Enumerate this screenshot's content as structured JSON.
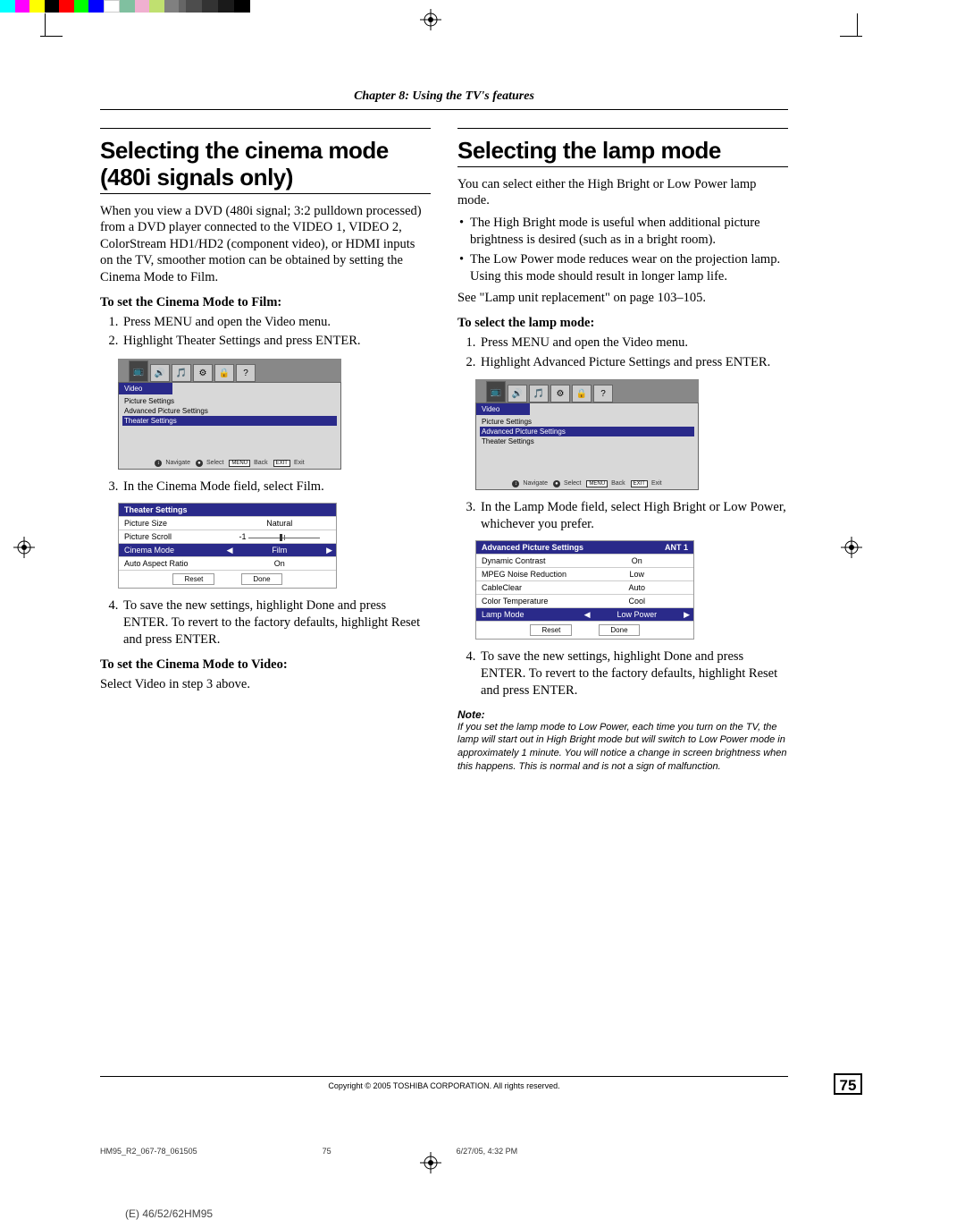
{
  "chapter": "Chapter 8: Using the TV's features",
  "left": {
    "heading": "Selecting the cinema mode (480i signals only)",
    "intro": "When you view a DVD (480i signal; 3:2 pulldown processed) from a DVD player connected to the VIDEO 1, VIDEO 2, ColorStream HD1/HD2 (component video), or HDMI inputs on the TV, smoother motion can be obtained by setting the Cinema Mode to Film.",
    "lead1": "To set the Cinema Mode to Film:",
    "step1": "Press MENU and open the Video menu.",
    "step2": "Highlight Theater Settings and press ENTER.",
    "osd": {
      "title": "Video",
      "items": [
        "Picture Settings",
        "Advanced Picture Settings",
        "Theater Settings"
      ],
      "footer": {
        "nav": "Navigate",
        "sel": "Select",
        "back": "Back",
        "exit": "Exit",
        "menu": "MENU",
        "exitbtn": "EXIT"
      }
    },
    "step3": "In the Cinema Mode field, select Film.",
    "table": {
      "title": "Theater Settings",
      "rows": [
        {
          "label": "Picture Size",
          "value": "Natural"
        },
        {
          "label": "Picture Scroll",
          "value": "-1"
        },
        {
          "label": "Cinema Mode",
          "value": "Film",
          "hl": true,
          "arrows": true
        },
        {
          "label": "Auto Aspect Ratio",
          "value": "On"
        }
      ],
      "buttons": [
        "Reset",
        "Done"
      ]
    },
    "step4": "To save the new settings, highlight Done and press ENTER. To revert to the factory defaults, highlight Reset and press ENTER.",
    "lead2": "To set the Cinema Mode to Video:",
    "lead2_text": "Select Video in step 3 above."
  },
  "right": {
    "heading": "Selecting the lamp mode",
    "intro": "You can select either the High Bright or Low Power lamp mode.",
    "bul1": "The High Bright mode is useful when additional picture brightness is desired (such as in a bright room).",
    "bul2": "The Low Power mode reduces wear on the projection lamp. Using this mode should result in longer lamp life.",
    "see": "See \"Lamp unit replacement\" on page 103–105.",
    "lead1": "To select the lamp mode:",
    "step1": "Press MENU and open the Video menu.",
    "step2": "Highlight Advanced Picture Settings and press ENTER.",
    "osd": {
      "title": "Video",
      "items": [
        "Picture Settings",
        "Advanced Picture Settings",
        "Theater Settings"
      ],
      "footer": {
        "nav": "Navigate",
        "sel": "Select",
        "back": "Back",
        "exit": "Exit",
        "menu": "MENU",
        "exitbtn": "EXIT"
      }
    },
    "step3": "In the Lamp Mode field, select High Bright or Low Power, whichever you prefer.",
    "table": {
      "title": "Advanced Picture Settings",
      "ant": "ANT 1",
      "rows": [
        {
          "label": "Dynamic Contrast",
          "value": "On"
        },
        {
          "label": "MPEG Noise Reduction",
          "value": "Low"
        },
        {
          "label": "CableClear",
          "value": "Auto"
        },
        {
          "label": "Color Temperature",
          "value": "Cool"
        },
        {
          "label": "Lamp Mode",
          "value": "Low Power",
          "hl": true,
          "arrows": true
        }
      ],
      "buttons": [
        "Reset",
        "Done"
      ]
    },
    "step4": "To save the new settings, highlight Done and press ENTER. To revert to the factory defaults, highlight Reset and press ENTER.",
    "note_head": "Note:",
    "note_text": "If you set the lamp mode to Low Power, each time you turn on the TV, the lamp will start out in High Bright mode but will switch to Low Power mode in approximately 1 minute. You will notice a change in screen brightness when this happens. This is normal and is not a sign of malfunction."
  },
  "footer": {
    "copyright": "Copyright © 2005 TOSHIBA CORPORATION. All rights reserved.",
    "page": "75",
    "file": "HM95_R2_067-78_061505",
    "filepage": "75",
    "date": "6/27/05, 4:32 PM",
    "model": "(E) 46/52/62HM95"
  },
  "colorbar_top_left": [
    "#fff",
    "#e6e6e6",
    "#ccc",
    "#b3b3b3",
    "#999",
    "#808080",
    "#666",
    "#4d4d4d",
    "#333",
    "#1a1a1a",
    "#000"
  ],
  "colorbar_top_right": [
    "#00ffff",
    "#ff00ff",
    "#ffff00",
    "#000",
    "#ff0000",
    "#00ff00",
    "#0000ff",
    "#fff",
    "#80c0a0",
    "#f0b0d0",
    "#c0e070",
    "#808080"
  ]
}
